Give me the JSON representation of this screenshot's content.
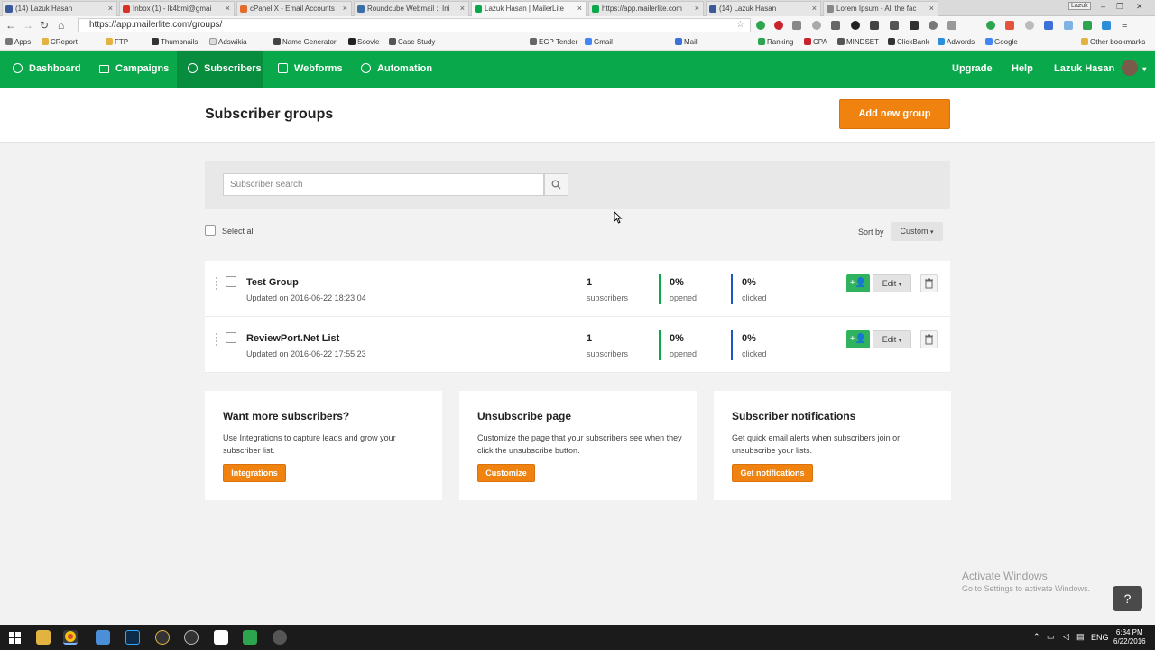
{
  "browser": {
    "tabs": [
      {
        "title": "(14) Lazuk Hasan",
        "color": "#3b5998"
      },
      {
        "title": "Inbox (1) - lk4bmi@gmai",
        "color": "#d93025"
      },
      {
        "title": "cPanel X - Email Accounts",
        "color": "#e56b2b"
      },
      {
        "title": "Roundcube Webmail :: Ini",
        "color": "#3a6ea5"
      },
      {
        "title": "Lazuk Hasan | MailerLite",
        "color": "#09a84a"
      },
      {
        "title": "https://app.mailerlite.com",
        "color": "#09a84a"
      },
      {
        "title": "(14) Lazuk Hasan",
        "color": "#3b5998"
      },
      {
        "title": "Lorem Ipsum - All the fac",
        "color": "#888888"
      }
    ],
    "profile_label": "Lazuk",
    "url": "https://app.mailerlite.com/groups/",
    "bookmarks": [
      "Apps",
      "CReport",
      "FTP",
      "Thumbnails",
      "Adswikia",
      "Name Generator",
      "Soovle",
      "Case Study",
      "EGP Tender",
      "Gmail",
      "Mail",
      "Ranking",
      "CPA",
      "MINDSET",
      "ClickBank",
      "Adwords",
      "Google"
    ],
    "other_bookmarks": "Other bookmarks"
  },
  "nav": {
    "items": [
      {
        "label": "Dashboard"
      },
      {
        "label": "Campaigns"
      },
      {
        "label": "Subscribers"
      },
      {
        "label": "Webforms"
      },
      {
        "label": "Automation"
      }
    ],
    "upgrade": "Upgrade",
    "help": "Help",
    "user": "Lazuk Hasan"
  },
  "page": {
    "title": "Subscriber groups",
    "add_group": "Add new group"
  },
  "search": {
    "placeholder": "Subscriber search"
  },
  "list": {
    "select_all": "Select all",
    "sort_by": "Sort by",
    "sort_value": "Custom",
    "edit_label": "Edit",
    "groups": [
      {
        "name": "Test Group",
        "updated": "Updated on 2016-06-22 18:23:04",
        "subscribers": "1",
        "subscribers_label": "subscribers",
        "opened": "0%",
        "opened_label": "opened",
        "clicked": "0%",
        "clicked_label": "clicked"
      },
      {
        "name": "ReviewPort.Net List",
        "updated": "Updated on 2016-06-22 17:55:23",
        "subscribers": "1",
        "subscribers_label": "subscribers",
        "opened": "0%",
        "opened_label": "opened",
        "clicked": "0%",
        "clicked_label": "clicked"
      }
    ]
  },
  "cards": [
    {
      "title": "Want more subscribers?",
      "text": "Use Integrations to capture leads and grow your subscriber list.",
      "button": "Integrations"
    },
    {
      "title": "Unsubscribe page",
      "text": "Customize the page that your subscribers see when they click the unsubscribe button.",
      "button": "Customize"
    },
    {
      "title": "Subscriber notifications",
      "text": "Get quick email alerts when subscribers join or unsubscribe your lists.",
      "button": "Get notifications"
    }
  ],
  "watermark": {
    "title": "Activate Windows",
    "subtitle": "Go to Settings to activate Windows."
  },
  "taskbar": {
    "lang": "ENG",
    "time": "6:34 PM",
    "date": "6/22/2016"
  },
  "colors": {
    "brand_green": "#09a84a",
    "accent_orange": "#f0830f",
    "opened_bar": "#09a84a",
    "clicked_bar": "#1e56c7"
  }
}
